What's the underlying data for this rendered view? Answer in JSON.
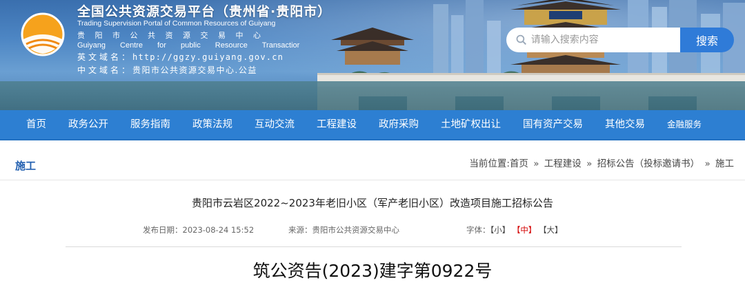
{
  "header": {
    "title_cn": "全国公共资源交易平台（贵州省·贵阳市）",
    "title_en": "Trading Supervision Portal of Common Resources of Guiyang",
    "centre_cn": "贵阳市公共资源交易中心",
    "centre_en": "Guiyang Centre for public Resource Transactior",
    "domain_en_label": "英文域名：",
    "domain_en_value": "http://ggzy.guiyang.gov.cn",
    "domain_cn_label": "中文域名：",
    "domain_cn_value": "贵阳市公共资源交易中心.公益"
  },
  "search": {
    "placeholder": "请输入搜索内容",
    "button_label": "搜索"
  },
  "nav": {
    "items": [
      {
        "label": "首页"
      },
      {
        "label": "政务公开"
      },
      {
        "label": "服务指南"
      },
      {
        "label": "政策法规"
      },
      {
        "label": "互动交流"
      },
      {
        "label": "工程建设"
      },
      {
        "label": "政府采购"
      },
      {
        "label": "土地矿权出让"
      },
      {
        "label": "国有资产交易"
      },
      {
        "label": "其他交易"
      },
      {
        "label": "金融服务"
      }
    ]
  },
  "section": {
    "title": "施工"
  },
  "breadcrumb": {
    "prefix": "当前位置:",
    "items": [
      "首页",
      "工程建设",
      "招标公告（投标邀请书）",
      "施工"
    ],
    "separator": "»"
  },
  "article": {
    "title": "贵阳市云岩区2022~2023年老旧小区（军产老旧小区）改造项目施工招标公告",
    "publish_label": "发布日期：",
    "publish_date": "2023-08-24 15:52",
    "source_label": "来源：",
    "source": "贵阳市公共资源交易中心",
    "font_size_label": "字体：",
    "font_sizes": [
      "【小】",
      "【中】",
      "【大】"
    ],
    "active_font_size": "【中】",
    "doc_number": "筑公资告(2023)建字第0922号"
  },
  "colors": {
    "nav_bg": "#2d7fd2",
    "search_button": "#2f7bd8",
    "section_title": "#2360b0",
    "active_font_size": "#d40000"
  }
}
